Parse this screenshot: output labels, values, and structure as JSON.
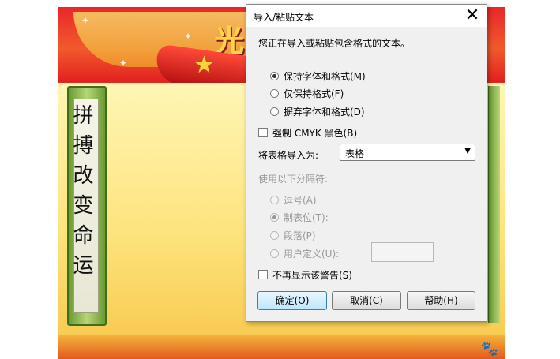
{
  "poster": {
    "title_chars": "光",
    "scroll_text": "拼搏改变命运"
  },
  "dialog": {
    "title": "导入/粘贴文本",
    "close_glyph": "✕",
    "message": "您正在导入或粘贴包含格式的文本。",
    "format_options": [
      {
        "label": "保持字体和格式(M)",
        "checked": true
      },
      {
        "label": "仅保持格式(F)",
        "checked": false
      },
      {
        "label": "摒弃字体和格式(D)",
        "checked": false
      }
    ],
    "force_cmyk_label": "强制 CMYK 黑色(B)",
    "import_table_label": "将表格导入为:",
    "import_table_value": "表格",
    "separator_label": "使用以下分隔符:",
    "separator_options": [
      {
        "label": "逗号(A)",
        "checked": false
      },
      {
        "label": "制表位(T):",
        "checked": true
      },
      {
        "label": "段落(P)",
        "checked": false
      },
      {
        "label": "用户定义(U):",
        "checked": false
      }
    ],
    "no_warning_label": "不再显示该警告(S)",
    "buttons": {
      "ok": "确定(O)",
      "cancel": "取消(C)",
      "help": "帮助(H)"
    }
  },
  "colors": {
    "poster_red": "#d8141b",
    "poster_yellow": "#fde37c",
    "dialog_bg": "#f0f0f0",
    "primary_button": "#bee6fd"
  }
}
